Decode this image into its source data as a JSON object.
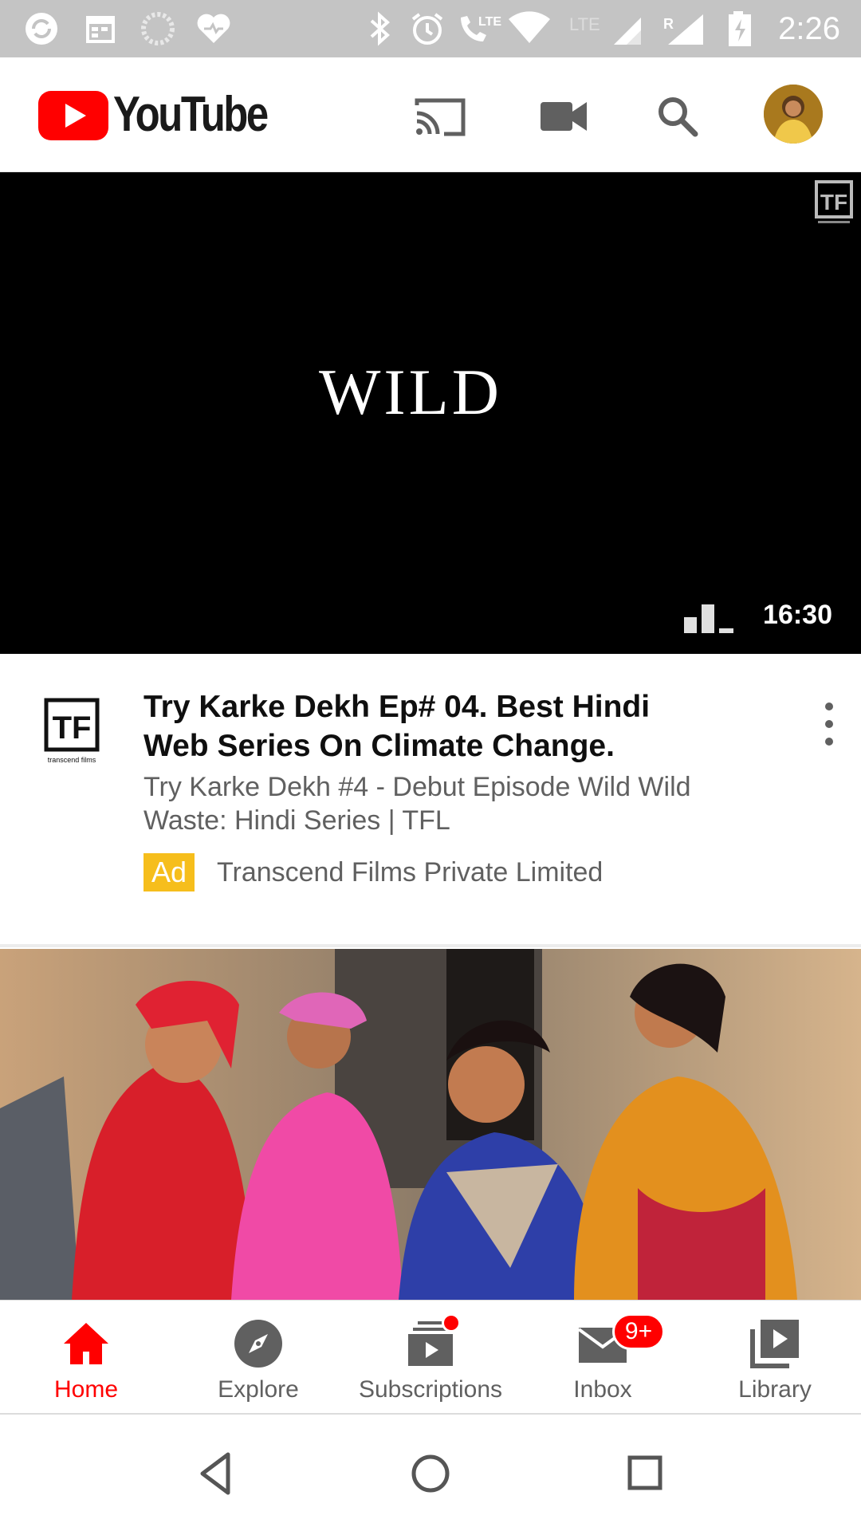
{
  "status_bar": {
    "time": "2:26",
    "network_label": "LTE",
    "icons": [
      "sync-icon",
      "calendar-icon",
      "loading-icon",
      "health-icon",
      "bluetooth-icon",
      "alarm-icon",
      "lte-call-icon",
      "wifi-icon",
      "signal-icon",
      "roaming-signal-icon",
      "battery-charging-icon"
    ]
  },
  "app_bar": {
    "logo_text": "YouTube",
    "actions": [
      "cast-icon",
      "camera-icon",
      "search-icon"
    ],
    "avatar": "account-avatar"
  },
  "player": {
    "title_card": "WILD",
    "brand_watermark": "TF",
    "duration": "16:30",
    "status_icon": "ad-stats-icon"
  },
  "ad": {
    "channel_logo_text": "TF",
    "channel_logo_caption": "transcend films",
    "title": "Try Karke Dekh Ep# 04. Best Hindi Web Series On Climate Change.",
    "description": "Try Karke Dekh #4 - Debut Episode Wild Wild Waste: Hindi Series | TFL",
    "badge": "Ad",
    "advertiser": "Transcend Films Private Limited",
    "badge_color": "#f6be1c"
  },
  "bottom_nav": {
    "items": [
      {
        "label": "Home",
        "icon": "home-icon",
        "active": true
      },
      {
        "label": "Explore",
        "icon": "compass-icon",
        "active": false
      },
      {
        "label": "Subscriptions",
        "icon": "subscriptions-icon",
        "active": false,
        "has_dot": true
      },
      {
        "label": "Inbox",
        "icon": "mail-icon",
        "active": false,
        "badge": "9+"
      },
      {
        "label": "Library",
        "icon": "library-icon",
        "active": false
      }
    ]
  },
  "system_nav": [
    "back-icon",
    "home-circle-icon",
    "recents-icon"
  ],
  "colors": {
    "brand_red": "#ff0000",
    "status_bar": "#c4c4c4",
    "secondary_text": "#606060"
  }
}
